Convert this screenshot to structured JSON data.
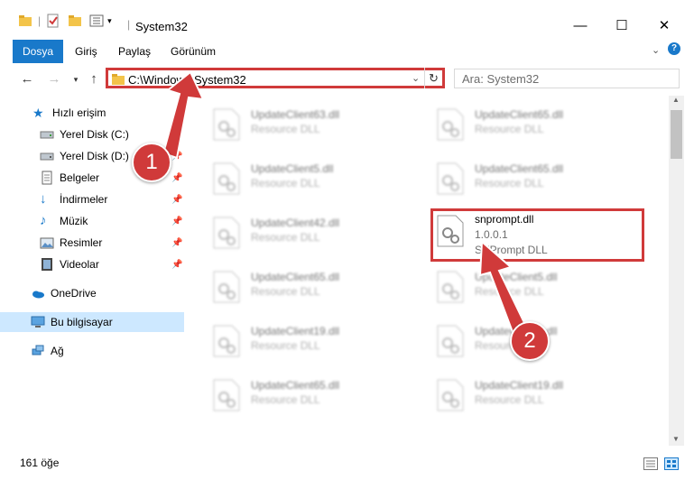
{
  "window": {
    "title": "System32"
  },
  "ribbon": {
    "tabs": [
      "Dosya",
      "Giriş",
      "Paylaş",
      "Görünüm"
    ]
  },
  "address": {
    "path": "C:\\Windows\\System32"
  },
  "search": {
    "placeholder": "Ara: System32"
  },
  "sidebar": {
    "items": [
      {
        "label": "Hızlı erişim",
        "icon": "star-icon",
        "pinned": false
      },
      {
        "label": "Yerel Disk (C:)",
        "icon": "drive-icon",
        "pinned": true
      },
      {
        "label": "Yerel Disk (D:)",
        "icon": "drive-icon",
        "pinned": true
      },
      {
        "label": "Belgeler",
        "icon": "documents-icon",
        "pinned": true
      },
      {
        "label": "İndirmeler",
        "icon": "download-icon",
        "pinned": true
      },
      {
        "label": "Müzik",
        "icon": "music-icon",
        "pinned": true
      },
      {
        "label": "Resimler",
        "icon": "pictures-icon",
        "pinned": true
      },
      {
        "label": "Videolar",
        "icon": "video-icon",
        "pinned": true
      },
      {
        "label": "OneDrive",
        "icon": "cloud-icon",
        "pinned": false
      },
      {
        "label": "Bu bilgisayar",
        "icon": "computer-icon",
        "pinned": false
      },
      {
        "label": "Ağ",
        "icon": "network-icon",
        "pinned": false
      }
    ]
  },
  "files": [
    {
      "name": "UpdateClient63.dll",
      "desc": "Resource DLL"
    },
    {
      "name": "UpdateClient65.dll",
      "desc": "Resource DLL"
    },
    {
      "name": "UpdateClient5.dll",
      "desc": "Resource DLL"
    },
    {
      "name": "UpdateClient65.dll",
      "desc": "Resource DLL"
    },
    {
      "name": "UpdateClient42.dll",
      "desc": "Resource DLL"
    },
    {
      "name": "snprompt.dll",
      "version": "1.0.0.1",
      "desc": "SNPrompt DLL"
    },
    {
      "name": "UpdateClient65.dll",
      "desc": "Resource DLL"
    },
    {
      "name": "UpdateClient5.dll",
      "desc": "Resource DLL"
    },
    {
      "name": "UpdateClient19.dll",
      "desc": "Resource DLL"
    },
    {
      "name": "UpdateClient5.dll",
      "desc": "Resource DLL"
    },
    {
      "name": "UpdateClient65.dll",
      "desc": "Resource DLL"
    },
    {
      "name": "UpdateClient19.dll",
      "desc": "Resource DLL"
    }
  ],
  "status": {
    "count": "161 öğe"
  },
  "annotations": {
    "badge1": "1",
    "badge2": "2",
    "color": "#d03a3a"
  }
}
